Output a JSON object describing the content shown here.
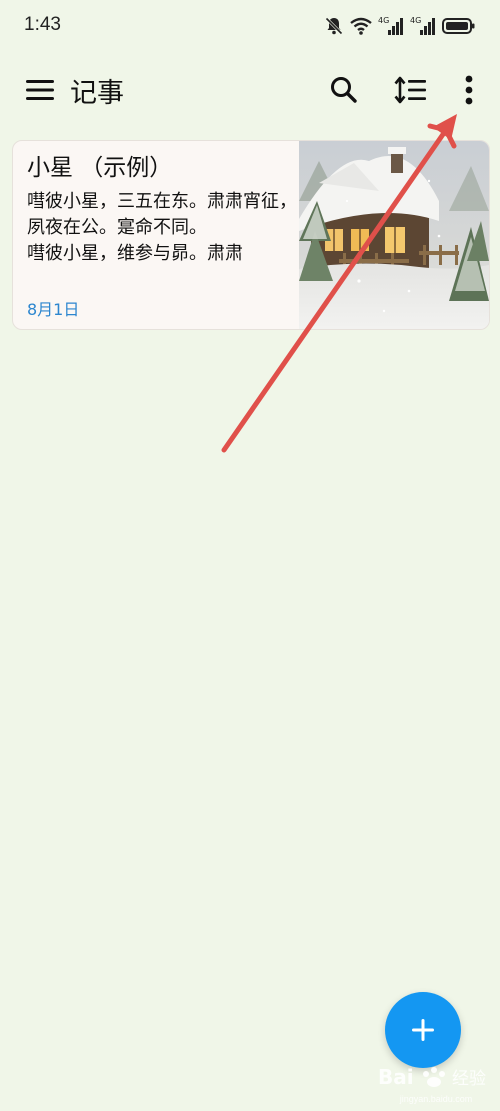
{
  "status_bar": {
    "time": "1:43",
    "icons": [
      "mute-bell-icon",
      "wifi-icon",
      "signal-4g-icon",
      "signal-4g-icon",
      "battery-icon"
    ],
    "network_labels": [
      "4G",
      "4G"
    ]
  },
  "app_bar": {
    "title": "记事",
    "icons": [
      "menu-icon",
      "search-icon",
      "sort-icon",
      "more-vert-icon"
    ]
  },
  "notes": [
    {
      "title": "小星 （示例）",
      "body": "嘒彼小星，三五在东。肃肃宵征，夙夜在公。寔命不同。\n嘒彼小星，维参与昴。肃肃",
      "date": "8月1日",
      "thumbnail": "snowy-cottage-image"
    }
  ],
  "fab": {
    "icon": "plus-icon"
  },
  "annotation": {
    "type": "red-arrow",
    "color": "#e0504a",
    "points_to": "more-vert-icon"
  },
  "watermark": {
    "logo": "Bai 经验",
    "text": "jingyan.baidu.com"
  },
  "colors": {
    "background": "#f0f6e8",
    "card": "#fbf7f4",
    "date": "#2c86cf",
    "fab": "#1497f2"
  }
}
